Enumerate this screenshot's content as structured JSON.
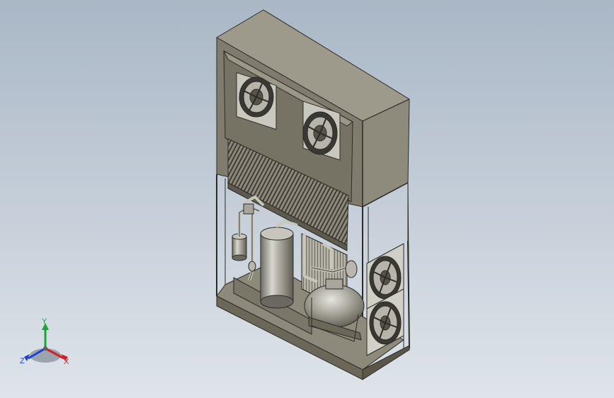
{
  "viewport": {
    "background_top": "#a9b7c6",
    "background_bottom": "#dfe4ea",
    "model_color": "#7d7a6b"
  },
  "triad": {
    "x_label": "X",
    "y_label": "Y",
    "z_label": "Z",
    "x_color": "#d2202a",
    "y_color": "#19a63a",
    "z_color": "#1f3fd8"
  }
}
